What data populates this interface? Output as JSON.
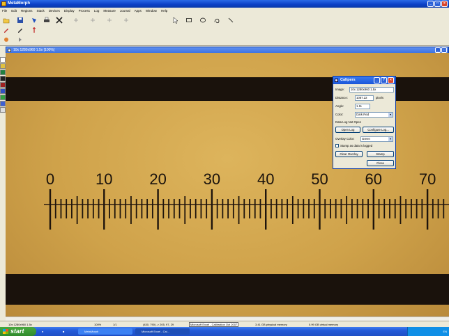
{
  "app": {
    "title": "MetaMorph"
  },
  "menu": [
    "File",
    "Edit",
    "Regions",
    "Stack",
    "Devices",
    "Display",
    "Process",
    "Log",
    "Measure",
    "Journal",
    "Apps",
    "Window",
    "Help"
  ],
  "image_window": {
    "title": "10x 1280x960 1.5x [100%]"
  },
  "ruler": {
    "labels": [
      "0",
      "10",
      "20",
      "30",
      "40",
      "50",
      "60",
      "70"
    ]
  },
  "calipers": {
    "title": "Calipers",
    "image_label": "Image:",
    "image_value": "10x 1280x960 1.5x",
    "distance_label": "Distance:",
    "distance_value": "1087.22",
    "distance_unit": "pixels",
    "angle_label": "Angle:",
    "angle_value": "1.11",
    "color_label": "Color:",
    "color_value": "Dark Red",
    "log_status": "Data Log Not Open",
    "open_log": "Open Log",
    "configure_log": "Configure Log...",
    "overlay_label": "Overlay Color:",
    "overlay_value": "Green",
    "stamp_check": "Stamp as data is logged",
    "clear_overlay": "Clear Overlay",
    "stamp": "Stamp",
    "close": "Close"
  },
  "statusbar": {
    "image": "10x 1280x960 1.5x",
    "zoom": "100%",
    "plane": "1/1",
    "coords": "(430, 790) -> 205, 97, 29",
    "excel": "Microsoft Excel - Calibration Oct 2007",
    "physical": "3.41 GB physical memory",
    "virtual": "0.99 GB virtual memory"
  },
  "taskbar": {
    "start": "start",
    "items": [
      "MetaMorph",
      "Microsoft Excel - Cal..."
    ],
    "tray": "EN"
  },
  "colors": {
    "titlebar": "#0b3fc6",
    "taskbar": "#235ad8",
    "start": "#2f8a2c",
    "micrograph": "#cfa24a"
  }
}
